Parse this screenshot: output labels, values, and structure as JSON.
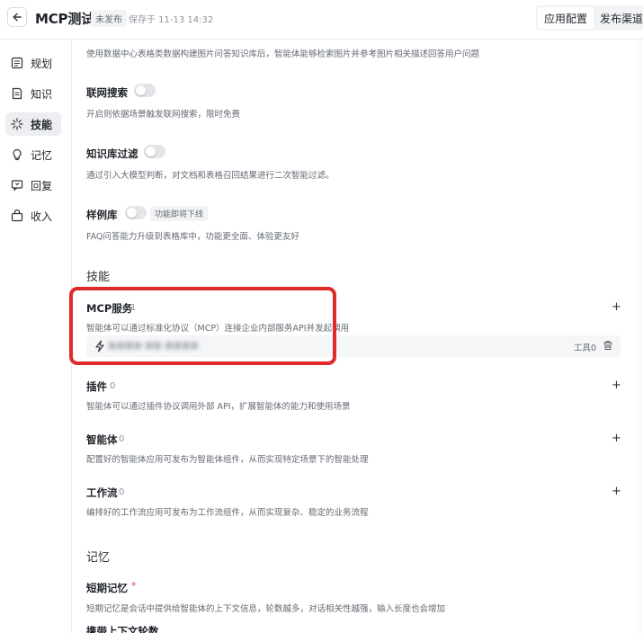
{
  "header": {
    "back_icon": "arrow-left-icon",
    "title": "MCP测试",
    "status": "未发布",
    "saved": "保存于 11-13 14:32",
    "tabs": [
      "应用配置",
      "发布渠道"
    ]
  },
  "sidebar": {
    "items": [
      {
        "label": "规划",
        "icon": "plan-icon"
      },
      {
        "label": "知识",
        "icon": "knowledge-icon"
      },
      {
        "label": "技能",
        "icon": "skill-icon",
        "active": true
      },
      {
        "label": "记忆",
        "icon": "memory-icon"
      },
      {
        "label": "回复",
        "icon": "reply-icon"
      },
      {
        "label": "收入",
        "icon": "income-icon"
      }
    ]
  },
  "knowledge": {
    "top_desc": "使用数据中心表格类数据构建图片问答知识库后，智能体能够检索图片并参考图片相关描述回答用户问题",
    "web_search": {
      "label": "联网搜索",
      "desc": "开启则依据场景触发联网搜索，限时免费",
      "enabled": false
    },
    "kb_filter": {
      "label": "知识库过滤",
      "desc": "通过引入大模型判断，对文档和表格召回结果进行二次智能过滤。",
      "enabled": false
    },
    "examples": {
      "label": "样例库",
      "tag": "功能即将下线",
      "desc": "FAQ问答能力升级到表格库中，功能更全面、体验更友好",
      "enabled": false
    }
  },
  "skills": {
    "section_title": "技能",
    "mcp": {
      "label": "MCP服务",
      "count": "1",
      "desc": "智能体可以通过标准化协议（MCP）连接企业内部服务API并发起调用",
      "server_name": "■■■■ ■■ ■■■■",
      "tools_label": "工具0"
    },
    "plugins": {
      "label": "插件",
      "count": "0",
      "desc": "智能体可以通过插件协议调用外部 API，扩展智能体的能力和使用场景"
    },
    "agents": {
      "label": "智能体",
      "count": "0",
      "desc": "配置好的智能体应用可发布为智能体组件，从而实现特定场景下的智能处理"
    },
    "workflows": {
      "label": "工作流",
      "count": "0",
      "desc": "编排好的工作流应用可发布为工作流组件，从而实现复杂、稳定的业务流程"
    },
    "add_symbol": "+"
  },
  "memory": {
    "section_title": "记忆",
    "short_term": {
      "label": "短期记忆",
      "required": "*",
      "desc": "短期记忆是会话中提供给智能体的上下文信息，轮数越多，对话相关性越强，输入长度也会增加"
    },
    "rounds_label": "携带上下文轮数"
  },
  "colors": {
    "highlight": "#e02b2b",
    "active_bg": "#eceef1"
  }
}
